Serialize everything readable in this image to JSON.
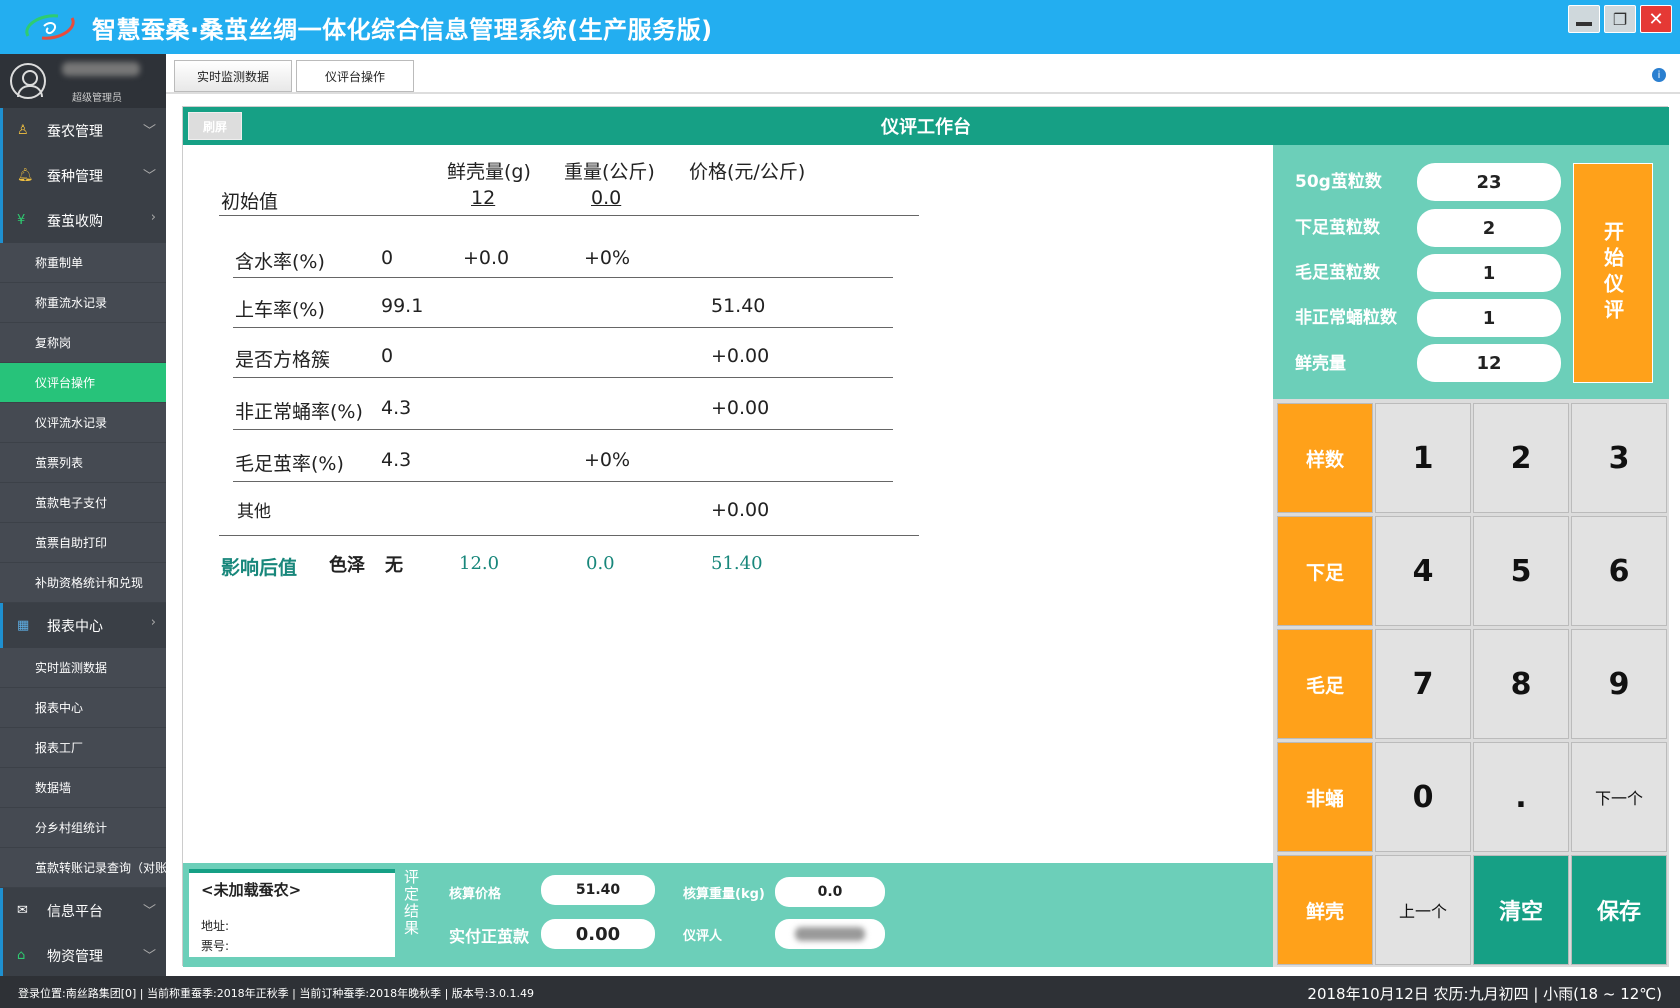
{
  "app": {
    "title": "智慧蚕桑·桑茧丝绸一体化综合信息管理系统(生产服务版)",
    "window_controls": [
      "minimize",
      "restore",
      "close"
    ]
  },
  "user": {
    "role": "超级管理员"
  },
  "sidebar": {
    "sections": [
      {
        "label": "蚕农管理",
        "icon": "person-icon"
      },
      {
        "label": "蚕种管理",
        "icon": "bell-icon"
      },
      {
        "label": "蚕茧收购",
        "icon": "yen-icon",
        "items": [
          "称重制单",
          "称重流水记录",
          "复称岗",
          "仪评台操作",
          "仪评流水记录",
          "茧票列表",
          "茧款电子支付",
          "茧票自助打印",
          "补助资格统计和兑现"
        ]
      },
      {
        "label": "报表中心",
        "icon": "table-icon",
        "items": [
          "实时监测数据",
          "报表中心",
          "报表工厂",
          "数据墙",
          "分乡村组统计",
          "茧款转账记录查询（对账"
        ]
      },
      {
        "label": "信息平台",
        "icon": "mail-icon"
      },
      {
        "label": "物资管理",
        "icon": "home-icon"
      }
    ],
    "active_item": "仪评台操作"
  },
  "tabs": [
    "实时监测数据",
    "仪评台操作"
  ],
  "panel": {
    "title": "仪评工作台",
    "refresh_label": "刷屏"
  },
  "calc": {
    "col_headers": [
      "鲜壳量(g)",
      "重量(公斤)",
      "价格(元/公斤)"
    ],
    "initial": {
      "label": "初始值",
      "shell": "12",
      "weight": "0.0"
    },
    "rows": [
      {
        "label": "含水率(%)",
        "value": "0",
        "c1": "+0.0",
        "c2": "+0%",
        "c3": ""
      },
      {
        "label": "上车率(%)",
        "value": "99.1",
        "c1": "",
        "c2": "",
        "c3": "51.40"
      },
      {
        "label": "是否方格簇",
        "value": "0",
        "c1": "",
        "c2": "",
        "c3": "+0.00"
      },
      {
        "label": "非正常蛹率(%)",
        "value": "4.3",
        "c1": "",
        "c2": "",
        "c3": "+0.00"
      },
      {
        "label": "毛足茧率(%)",
        "value": "4.3",
        "c1": "",
        "c2": "+0%",
        "c3": ""
      },
      {
        "label": "其他",
        "value": "",
        "c1": "",
        "c2": "",
        "c3": "+0.00"
      }
    ],
    "after": {
      "label": "影响后值",
      "color_label": "色泽",
      "color_value": "无",
      "shell": "12.0",
      "weight": "0.0",
      "price": "51.40"
    }
  },
  "result": {
    "farmer_name": "<未加载蚕农>",
    "address_label": "地址:",
    "ticket_label": "票号:",
    "vertical_label": "评定结果",
    "calc_price_label": "核算价格",
    "calc_price": "51.40",
    "calc_weight_label": "核算重量(kg)",
    "calc_weight": "0.0",
    "actual_label": "实付正茧款",
    "actual_value": "0.00",
    "evaluator_label": "仪评人"
  },
  "counter": {
    "fields": [
      {
        "label": "50g茧粒数",
        "value": "23"
      },
      {
        "label": "下足茧粒数",
        "value": "2"
      },
      {
        "label": "毛足茧粒数",
        "value": "1"
      },
      {
        "label": "非正常蛹粒数",
        "value": "1"
      },
      {
        "label": "鲜壳量",
        "value": "12"
      }
    ],
    "start_label": "开始仪评"
  },
  "keypad": {
    "rows": [
      [
        "样数",
        "1",
        "2",
        "3"
      ],
      [
        "下足",
        "4",
        "5",
        "6"
      ],
      [
        "毛足",
        "7",
        "8",
        "9"
      ],
      [
        "非蛹",
        "0",
        ".",
        "下一个"
      ],
      [
        "鲜壳",
        "上一个",
        "清空",
        "保存"
      ]
    ]
  },
  "status": {
    "left": "登录位置:南丝路集团[0] | 当前称重蚕季:2018年正秋季 | 当前订种蚕季:2018年晚秋季 | 版本号:3.0.1.49",
    "right": "2018年10月12日 农历:九月初四 | 小雨(18 ~ 12℃)"
  },
  "colors": {
    "titlebar": "#23aef0",
    "teal": "#16a085",
    "orange": "#ffa11a",
    "active": "#27c37a"
  }
}
